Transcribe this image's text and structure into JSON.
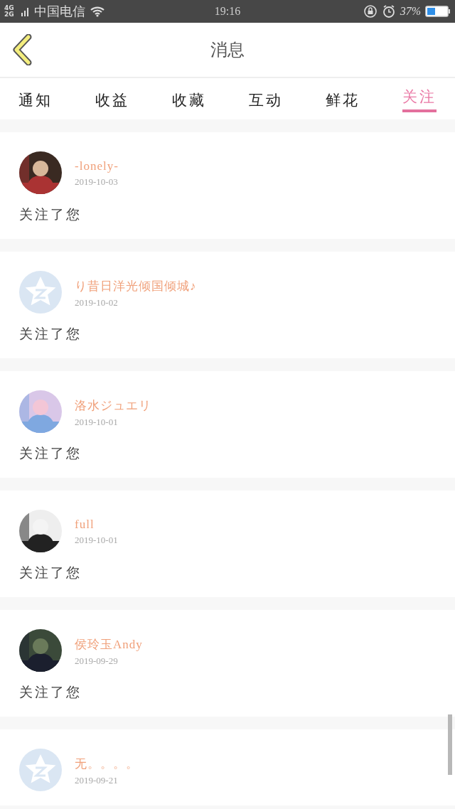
{
  "status_bar": {
    "network": "4G 2G",
    "carrier": "中国电信",
    "time": "19:16",
    "battery": "37%"
  },
  "header": {
    "title": "消息"
  },
  "tabs": [
    {
      "label": "通知",
      "selected": false
    },
    {
      "label": "收益",
      "selected": false
    },
    {
      "label": "收藏",
      "selected": false
    },
    {
      "label": "互动",
      "selected": false
    },
    {
      "label": "鲜花",
      "selected": false
    },
    {
      "label": "关注",
      "selected": true
    }
  ],
  "messages": [
    {
      "name": "-lonely-",
      "date": "2019-10-03",
      "text": "关注了您"
    },
    {
      "name": "り昔日洋光倾国倾城♪",
      "date": "2019-10-02",
      "text": "关注了您",
      "avatar": {
        "kind": "default"
      }
    },
    {
      "name": "洛水ジュエリ",
      "date": "2019-10-01",
      "text": "关注了您"
    },
    {
      "name": "full",
      "date": "2019-10-01",
      "text": "关注了您"
    },
    {
      "name": "侯玲玉Andy",
      "date": "2019-09-29",
      "text": "关注了您"
    },
    {
      "name": "无。。。。",
      "date": "2019-09-21",
      "avatar": {
        "kind": "default"
      }
    }
  ]
}
